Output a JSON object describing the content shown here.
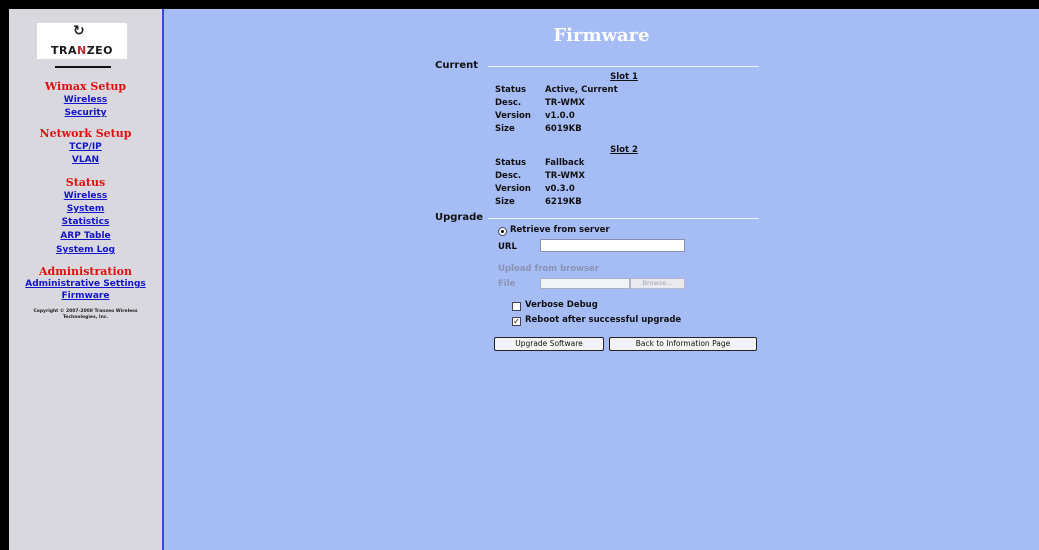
{
  "sidebar": {
    "logo": {
      "word_pre": "TRA",
      "word_mid": "N",
      "word_post": "ZEO",
      "mark_icon": "tranzeo-swirl-icon"
    },
    "sections": [
      {
        "title": "Wimax Setup",
        "links": [
          "Wireless",
          "Security"
        ]
      },
      {
        "title": "Network Setup",
        "links": [
          "TCP/IP",
          "VLAN"
        ]
      },
      {
        "title": "Status",
        "links": [
          "Wireless",
          "System",
          "Statistics",
          "ARP Table",
          "System Log"
        ]
      },
      {
        "title": "Administration",
        "links": [
          "Administrative Settings",
          "Firmware"
        ]
      }
    ],
    "copyright_line1": "Copyright © 2007-2008 Tranzeo Wireless",
    "copyright_line2": "Technologies, Inc."
  },
  "main": {
    "title": "Firmware",
    "current_label": "Current",
    "upgrade_label": "Upgrade",
    "slots": [
      {
        "heading": "Slot 1",
        "status": "Active, Current",
        "desc": "TR-WMX",
        "version": "v1.0.0",
        "size": "6019KB"
      },
      {
        "heading": "Slot 2",
        "status": "Fallback",
        "desc": "TR-WMX",
        "version": "v0.3.0",
        "size": "6219KB"
      }
    ],
    "keys": {
      "status": "Status",
      "desc": "Desc.",
      "version": "Version",
      "size": "Size"
    },
    "upgrade": {
      "retrieve_label": "Retrieve from server",
      "url_label": "URL",
      "url_value": "",
      "upload_label": "Upload from browser",
      "file_label": "File",
      "file_value": "",
      "browse_label": "Browse...",
      "verbose_label": "Verbose Debug",
      "verbose_checked": false,
      "reboot_label": "Reboot after successful upgrade",
      "reboot_checked": true,
      "upgrade_button": "Upgrade Software",
      "back_button": "Back to Information Page"
    }
  }
}
